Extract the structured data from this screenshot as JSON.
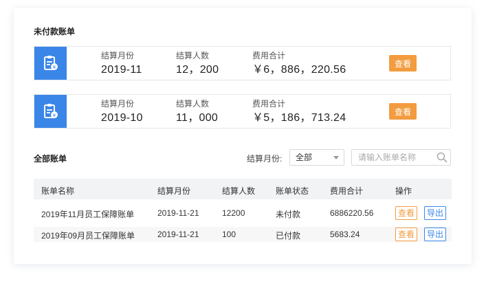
{
  "unpaid": {
    "title": "未付款账单",
    "bills": [
      {
        "month_label": "结算月份",
        "month": "2019-11",
        "people_label": "结算人数",
        "people": "12，200",
        "total_label": "费用合计",
        "total": "￥6，886，220.56",
        "view_label": "查看"
      },
      {
        "month_label": "结算月份",
        "month": "2019-10",
        "people_label": "结算人数",
        "people": "11，000",
        "total_label": "费用合计",
        "total": "￥5，186，713.24",
        "view_label": "查看"
      }
    ]
  },
  "all": {
    "title": "全部账单",
    "filter_label": "结算月份:",
    "select_value": "全部",
    "search_placeholder": "请输入账单名称",
    "columns": [
      "账单名称",
      "结算月份",
      "结算人数",
      "账单状态",
      "费用合计",
      "操作"
    ],
    "rows": [
      {
        "name": "2019年11月员工保障账单",
        "month": "2019-11-21",
        "people": "12200",
        "status": "未付款",
        "total": "6886220.56",
        "view": "查看",
        "export": "导出"
      },
      {
        "name": "2019年09月员工保障账单",
        "month": "2019-11-21",
        "people": "100",
        "status": "已付款",
        "total": "5683.24",
        "view": "查看",
        "export": "导出"
      }
    ]
  },
  "colors": {
    "accent_blue": "#3a86e8",
    "accent_orange": "#f39c3f"
  },
  "icons": {
    "bill_icon": "clipboard-yen-icon",
    "search_icon": "search-icon"
  }
}
